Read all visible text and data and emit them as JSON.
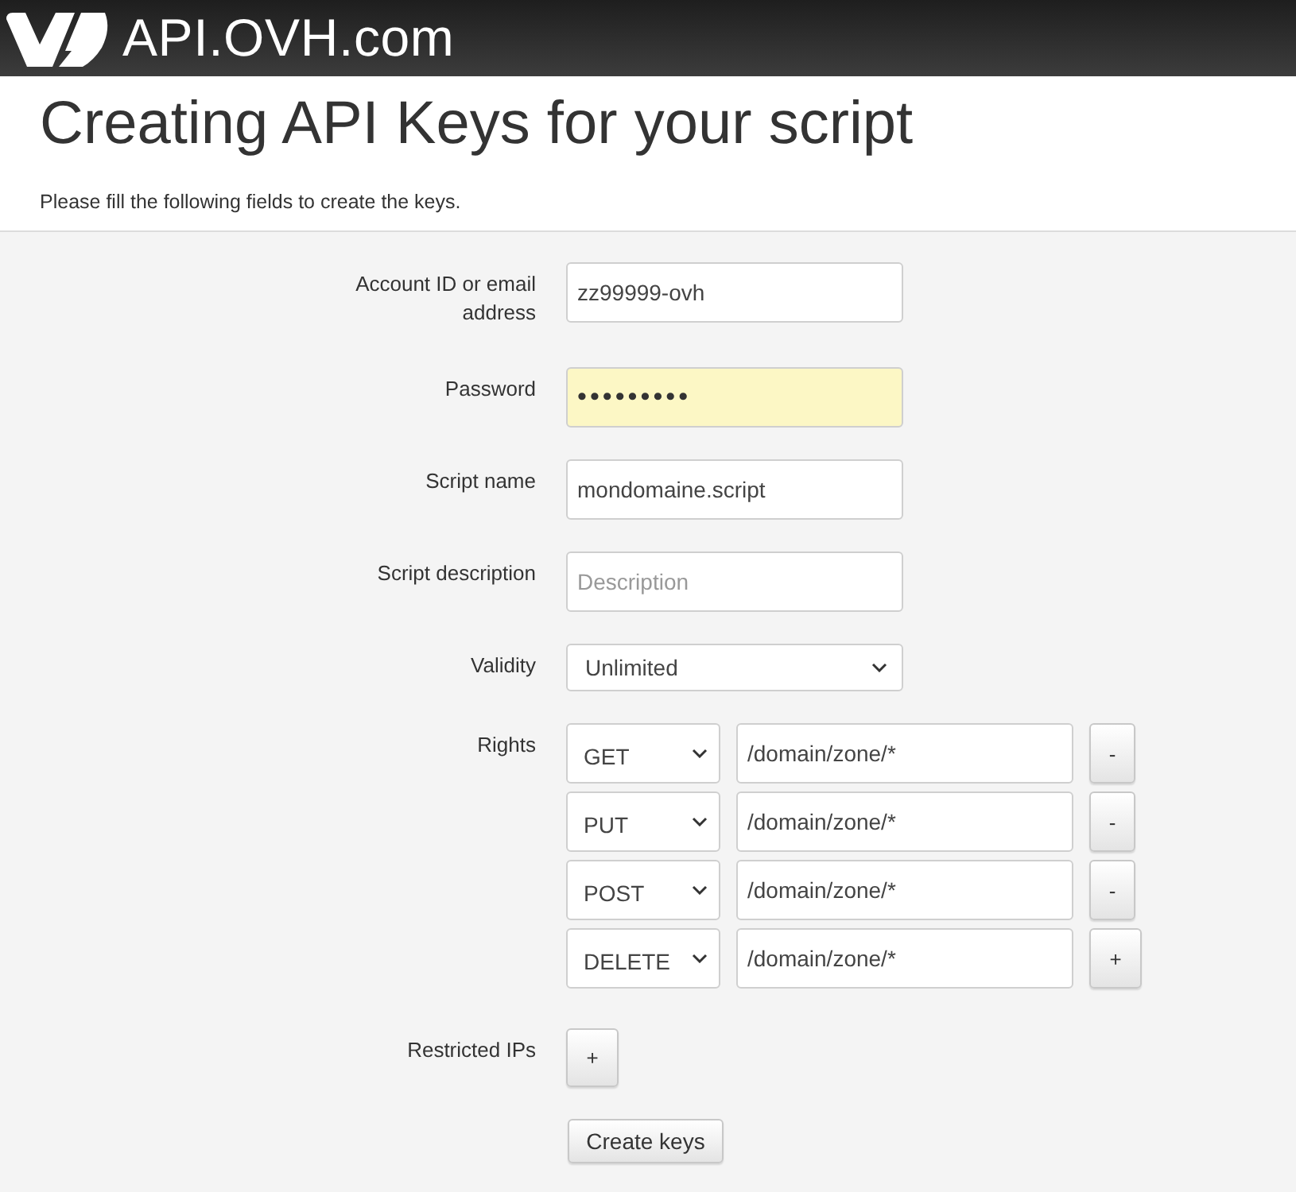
{
  "header": {
    "logo_text": "API.OVH.com"
  },
  "banner": {
    "title": "Creating API Keys for your script",
    "subtitle": "Please fill the following fields to create the keys."
  },
  "form": {
    "fields": [
      {
        "kind": "text",
        "label": "Account ID or email address",
        "value": "zz99999-ovh",
        "highlighted": false
      },
      {
        "kind": "password",
        "label": "Password",
        "value": "•••••••••",
        "highlighted": true
      },
      {
        "kind": "text",
        "label": "Script name",
        "value": "mondomaine.script",
        "highlighted": false
      },
      {
        "kind": "text",
        "label": "Script description",
        "placeholder": "Description",
        "highlighted": false
      },
      {
        "kind": "select",
        "label": "Validity",
        "value": "Unlimited"
      },
      {
        "kind": "rights",
        "label": "Rights",
        "rows": [
          {
            "method": "GET",
            "path": "/domain/zone/*",
            "button": {
              "kind": "remove",
              "label": "-"
            }
          },
          {
            "method": "PUT",
            "path": "/domain/zone/*",
            "button": {
              "kind": "remove",
              "label": "-"
            }
          },
          {
            "method": "POST",
            "path": "/domain/zone/*",
            "button": {
              "kind": "remove",
              "label": "-"
            }
          },
          {
            "method": "DELETE",
            "path": "/domain/zone/*",
            "button": {
              "kind": "add",
              "label": "+"
            }
          }
        ]
      },
      {
        "kind": "add",
        "label": "Restricted IPs",
        "button": "+"
      }
    ],
    "submit": "Create keys"
  }
}
